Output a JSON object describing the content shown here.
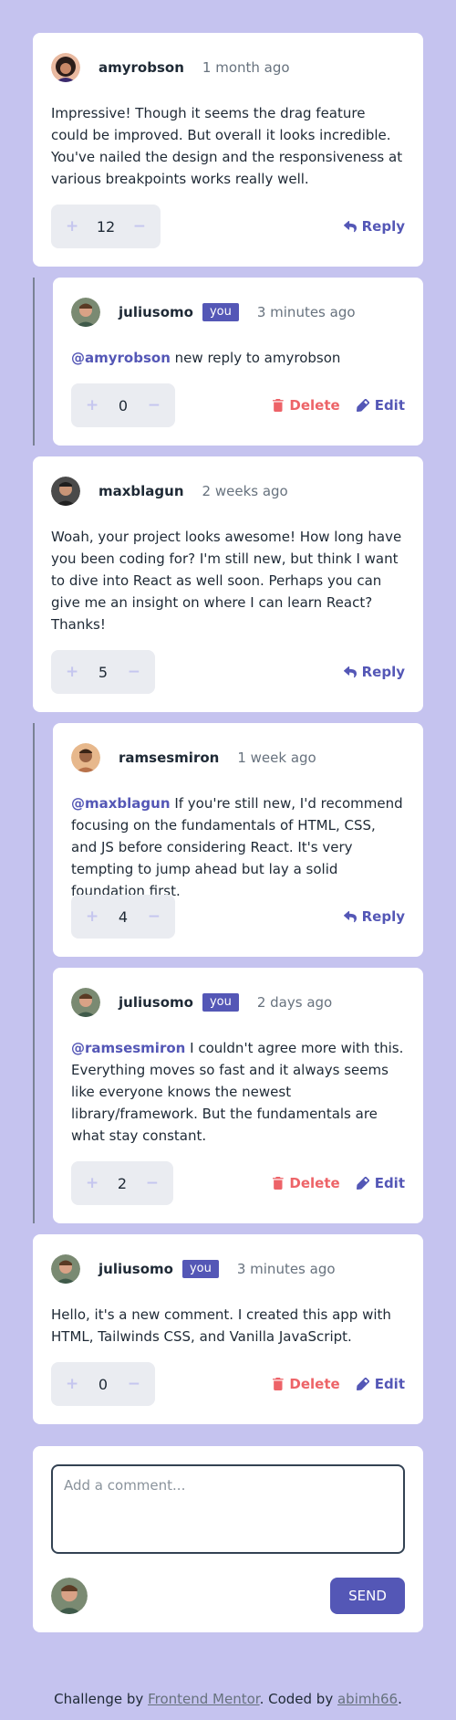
{
  "comments": [
    {
      "username": "amyrobson",
      "time": "1 month ago",
      "text": "Impressive! Though it seems the drag feature could be improved. But overall it looks incredible. You've nailed the design and the responsiveness at various breakpoints works really well.",
      "score": "12",
      "reply_label": "Reply"
    },
    {
      "username": "juliusomo",
      "you_badge": "you",
      "time": "3 minutes ago",
      "mention": "@amyrobson",
      "text": "new reply to amyrobson",
      "score": "0",
      "delete_label": "Delete",
      "edit_label": "Edit"
    },
    {
      "username": "maxblagun",
      "time": "2 weeks ago",
      "text": "Woah, your project looks awesome! How long have you been coding for? I'm still new, but think I want to dive into React as well soon. Perhaps you can give me an insight on where I can learn React? Thanks!",
      "score": "5",
      "reply_label": "Reply"
    },
    {
      "username": "ramsesmiron",
      "time": "1 week ago",
      "mention": "@maxblagun",
      "text": "If you're still new, I'd recommend focusing on the fundamentals of HTML, CSS, and JS before considering React. It's very tempting to jump ahead but lay a solid foundation first.",
      "score": "4",
      "reply_label": "Reply"
    },
    {
      "username": "juliusomo",
      "you_badge": "you",
      "time": "2 days ago",
      "mention": "@ramsesmiron",
      "text": "I couldn't agree more with this. Everything moves so fast and it always seems like everyone knows the newest library/framework. But the fundamentals are what stay constant.",
      "score": "2",
      "delete_label": "Delete",
      "edit_label": "Edit"
    },
    {
      "username": "juliusomo",
      "you_badge": "you",
      "time": "3 minutes ago",
      "text": "Hello, it's a new comment. I created this app with HTML, Tailwinds CSS, and Vanilla JavaScript.",
      "score": "0",
      "delete_label": "Delete",
      "edit_label": "Edit"
    }
  ],
  "vote": {
    "plus": "+",
    "minus": "−"
  },
  "add_comment": {
    "placeholder": "Add a comment...",
    "send_label": "SEND"
  },
  "footer": {
    "prefix": "Challenge by",
    "link1": "Frontend Mentor",
    "middle": ". Coded by",
    "link2": "abimh66",
    "suffix": "."
  },
  "colors": {
    "background": "#c5c3ef",
    "accent": "#5457b6",
    "danger": "#ed6468",
    "vote_bg": "#eaecf1"
  },
  "icons": [
    "reply-icon",
    "delete-icon",
    "edit-icon",
    "avatar"
  ]
}
